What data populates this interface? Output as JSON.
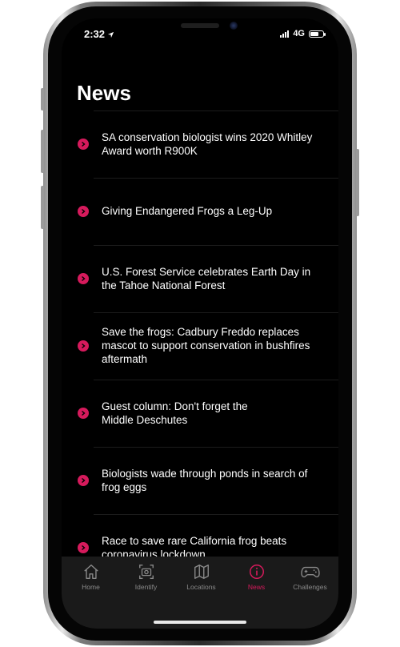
{
  "status_bar": {
    "time": "2:32",
    "network": "4G"
  },
  "page": {
    "title": "News"
  },
  "news": [
    {
      "title": "SA conservation biologist wins 2020 Whitley Award worth R900K"
    },
    {
      "title": "Giving Endangered Frogs a Leg-Up"
    },
    {
      "title": "U.S. Forest Service celebrates Earth Day in the Tahoe National Forest"
    },
    {
      "title": "Save the frogs: Cadbury Freddo replaces mascot to support conservation in bushfires aftermath"
    },
    {
      "title": "Guest column: Don't forget the Middle Deschutes"
    },
    {
      "title": "Biologists wade through ponds in search of frog eggs"
    },
    {
      "title": "Race to save rare California frog beats coronavirus lockdown"
    }
  ],
  "tabs": [
    {
      "label": "Home",
      "icon": "home-icon"
    },
    {
      "label": "Identify",
      "icon": "camera-scan-icon"
    },
    {
      "label": "Locations",
      "icon": "map-icon"
    },
    {
      "label": "News",
      "icon": "info-icon",
      "active": true
    },
    {
      "label": "Challenges",
      "icon": "gamepad-icon"
    }
  ],
  "colors": {
    "accent": "#d61a5c",
    "background": "#000000",
    "tabbar": "#1a1a1a"
  }
}
